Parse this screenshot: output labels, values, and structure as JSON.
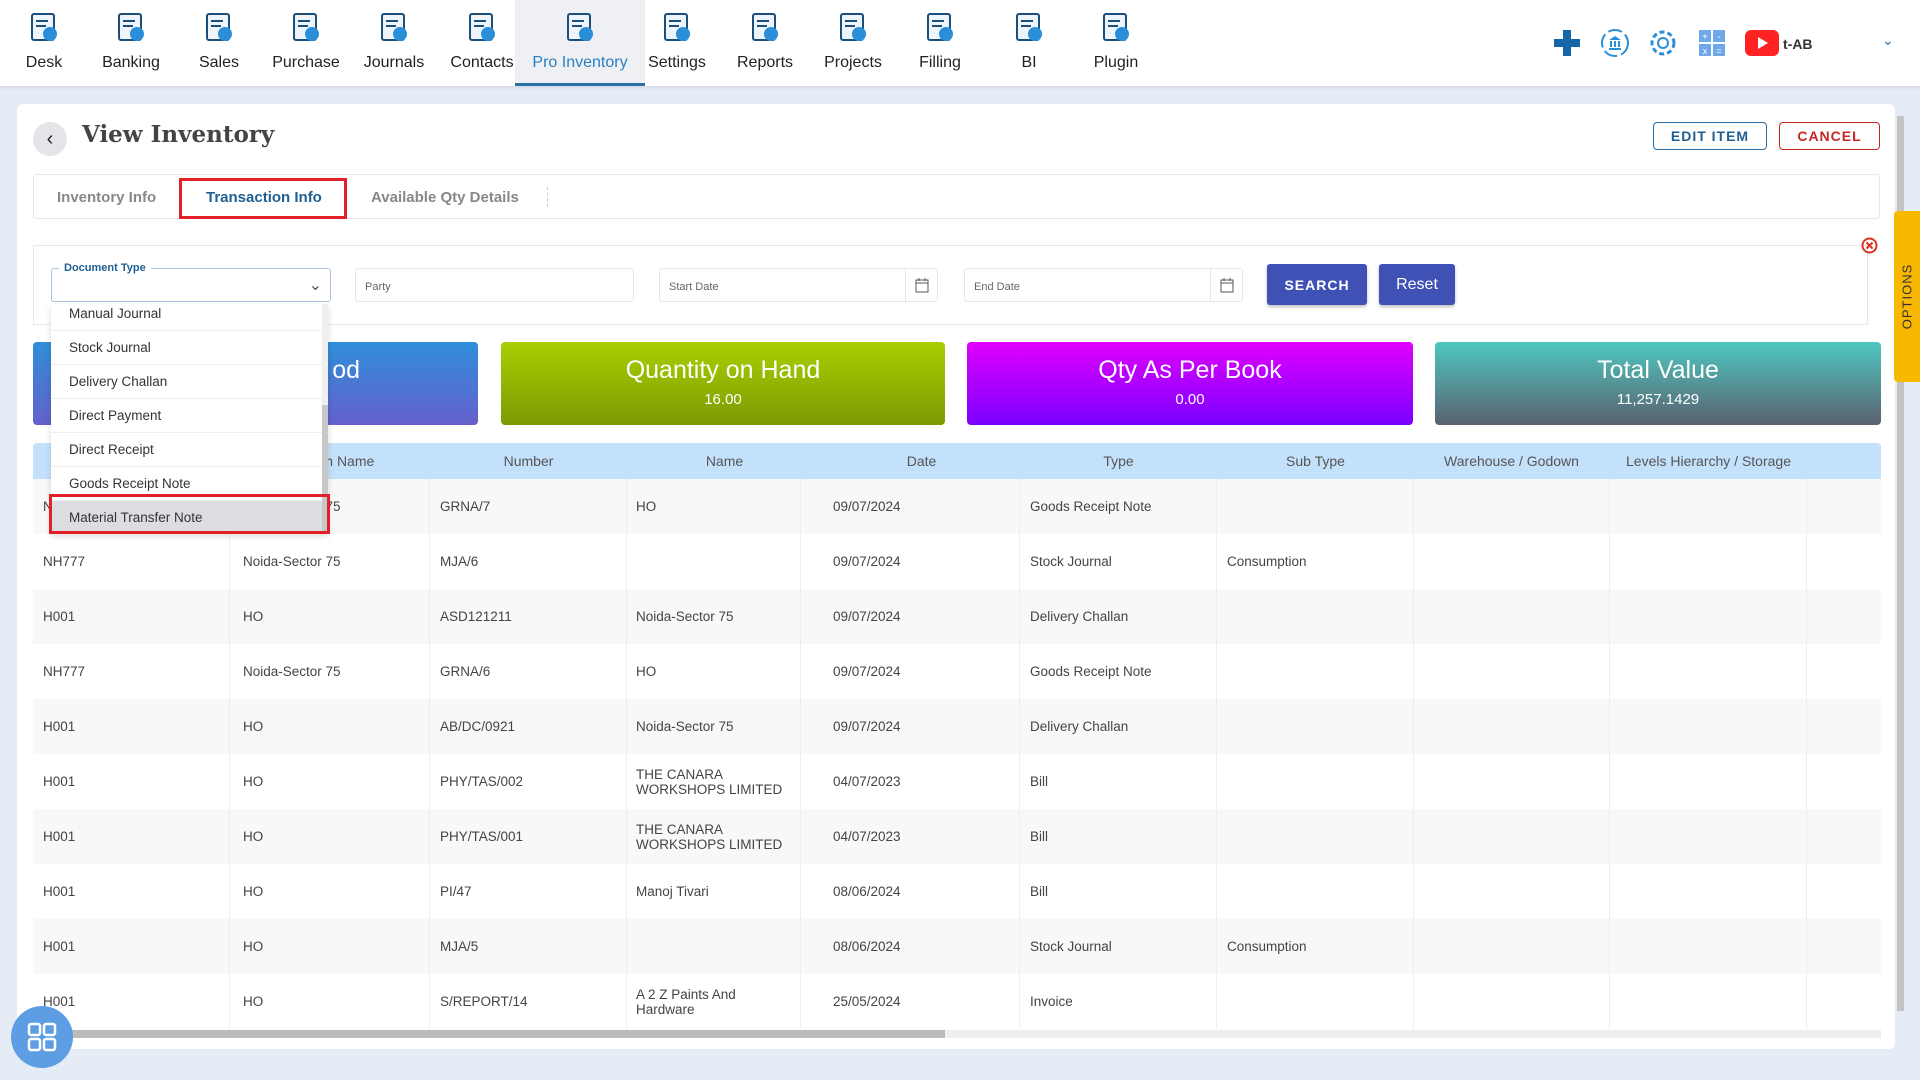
{
  "nav": {
    "items": [
      {
        "label": "Desk",
        "icon": "desk-icon"
      },
      {
        "label": "Banking",
        "icon": "bank-icon"
      },
      {
        "label": "Sales",
        "icon": "sales-icon"
      },
      {
        "label": "Purchase",
        "icon": "purchase-icon"
      },
      {
        "label": "Journals",
        "icon": "journals-icon"
      },
      {
        "label": "Contacts",
        "icon": "contacts-icon"
      },
      {
        "label": "Pro Inventory",
        "icon": "inventory-icon",
        "active": true
      },
      {
        "label": "Settings",
        "icon": "settings-tools-icon"
      },
      {
        "label": "Reports",
        "icon": "reports-icon"
      },
      {
        "label": "Projects",
        "icon": "projects-icon"
      },
      {
        "label": "Filling",
        "icon": "filling-icon"
      },
      {
        "label": "BI",
        "icon": "bi-icon"
      },
      {
        "label": "Plugin",
        "icon": "plugin-icon"
      }
    ],
    "user": "t-AB"
  },
  "page": {
    "title": "View Inventory",
    "edit_label": "EDIT ITEM",
    "cancel_label": "CANCEL"
  },
  "tabs": [
    "Inventory Info",
    "Transaction Info",
    "Available Qty Details"
  ],
  "filters": {
    "doc_type_label": "Document Type",
    "party_placeholder": "Party",
    "start_placeholder": "Start Date",
    "end_placeholder": "End Date",
    "search_label": "SEARCH",
    "reset_label": "Reset",
    "options_label": "OPTIONS"
  },
  "dropdown": [
    "Manual Journal",
    "Stock Journal",
    "Delivery Challan",
    "Direct Payment",
    "Direct Receipt",
    "Goods Receipt Note",
    "Material Transfer Note"
  ],
  "stats": [
    {
      "title": "od",
      "value": ""
    },
    {
      "title": "Quantity on Hand",
      "value": "16.00"
    },
    {
      "title": "Qty As Per Book",
      "value": "0.00"
    },
    {
      "title": "Total Value",
      "value": "11,257.1429"
    }
  ],
  "colors": {
    "accent": "#3f51b5",
    "highlight_box": "#e32028",
    "header_bg": "#c4e1fb",
    "options_tab": "#f9b800"
  },
  "table": {
    "headers": [
      "",
      "Branch Name",
      "Number",
      "Name",
      "Date",
      "Type",
      "Sub Type",
      "Warehouse / Godown",
      "Levels Hierarchy / Storage",
      ""
    ],
    "rows": [
      [
        "NH777",
        "Noida-Sector 75",
        "GRNA/7",
        "HO",
        "09/07/2024",
        "Goods Receipt Note",
        "",
        "",
        "",
        ""
      ],
      [
        "NH777",
        "Noida-Sector 75",
        "MJA/6",
        "",
        "09/07/2024",
        "Stock Journal",
        "Consumption",
        "",
        "",
        ""
      ],
      [
        "H001",
        "HO",
        "ASD121211",
        "Noida-Sector 75",
        "09/07/2024",
        "Delivery Challan",
        "",
        "",
        "",
        ""
      ],
      [
        "NH777",
        "Noida-Sector 75",
        "GRNA/6",
        "HO",
        "09/07/2024",
        "Goods Receipt Note",
        "",
        "",
        "",
        ""
      ],
      [
        "H001",
        "HO",
        "AB/DC/0921",
        "Noida-Sector 75",
        "09/07/2024",
        "Delivery Challan",
        "",
        "",
        "",
        ""
      ],
      [
        "H001",
        "HO",
        "PHY/TAS/002",
        "THE CANARA WORKSHOPS LIMITED",
        "04/07/2023",
        "Bill",
        "",
        "",
        "",
        ""
      ],
      [
        "H001",
        "HO",
        "PHY/TAS/001",
        "THE CANARA WORKSHOPS LIMITED",
        "04/07/2023",
        "Bill",
        "",
        "",
        "",
        ""
      ],
      [
        "H001",
        "HO",
        "PI/47",
        "Manoj Tivari",
        "08/06/2024",
        "Bill",
        "",
        "",
        "",
        ""
      ],
      [
        "H001",
        "HO",
        "MJA/5",
        "",
        "08/06/2024",
        "Stock Journal",
        "Consumption",
        "",
        "",
        ""
      ],
      [
        "H001",
        "HO",
        "S/REPORT/14",
        "A 2 Z Paints And Hardware",
        "25/05/2024",
        "Invoice",
        "",
        "",
        "",
        ""
      ]
    ]
  }
}
